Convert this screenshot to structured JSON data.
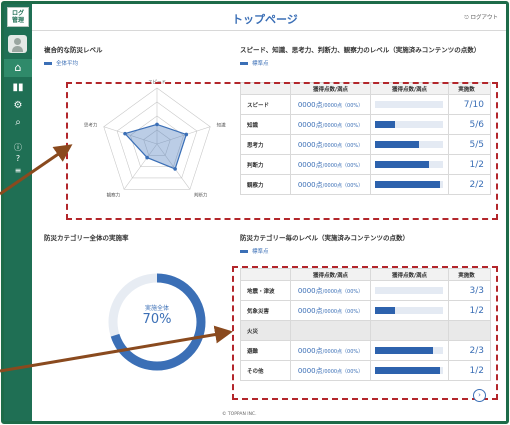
{
  "app": {
    "logo": "ログ\n管理",
    "title": "トップページ",
    "logout": "ログアウト"
  },
  "left_top": {
    "title": "複合的な防災レベル",
    "legend": "全体平均"
  },
  "right_top": {
    "title": "スピード、知識、思考力、判断力、観察力のレベル（実施済みコンテンツの点数）",
    "legend": "標準点",
    "headers": [
      "",
      "獲得点数/満点",
      "獲得点数/満点",
      "実施数"
    ],
    "rows": [
      {
        "name": "スピード",
        "score": "0000点",
        "detail": "/0000点（00%）",
        "fill": 0.0,
        "count": "7/10"
      },
      {
        "name": "知識",
        "score": "0000点",
        "detail": "/0000点（00%）",
        "fill": 0.3,
        "count": "5/6"
      },
      {
        "name": "思考力",
        "score": "0000点",
        "detail": "/0000点（00%）",
        "fill": 0.65,
        "count": "5/5"
      },
      {
        "name": "判断力",
        "score": "0000点",
        "detail": "/0000点（00%）",
        "fill": 0.8,
        "count": "1/2"
      },
      {
        "name": "観察力",
        "score": "0000点",
        "detail": "/0000点（00%）",
        "fill": 0.95,
        "count": "2/2"
      }
    ]
  },
  "left_bottom": {
    "title": "防災カテゴリー全体の実施率",
    "donut_label": "実施全体",
    "percent": "70%",
    "rate": 0.7
  },
  "right_bottom": {
    "title": "防災カテゴリー毎のレベル（実施済みコンテンツの点数）",
    "legend": "標準点",
    "headers": [
      "",
      "獲得点数/満点",
      "獲得点数/満点",
      "実施数"
    ],
    "rows": [
      {
        "name": "地震・津波",
        "score": "0000点",
        "detail": "/0000点（00%）",
        "fill": 0.0,
        "count": "3/3",
        "gray": false
      },
      {
        "name": "気象災害",
        "score": "0000点",
        "detail": "/0000点（00%）",
        "fill": 0.3,
        "count": "1/2",
        "gray": false
      },
      {
        "name": "火災",
        "score": "",
        "detail": "",
        "fill": null,
        "count": "",
        "gray": true
      },
      {
        "name": "避難",
        "score": "0000点",
        "detail": "/0000点（00%）",
        "fill": 0.85,
        "count": "2/3",
        "gray": false
      },
      {
        "name": "その他",
        "score": "0000点",
        "detail": "/0000点（00%）",
        "fill": 0.95,
        "count": "1/2",
        "gray": false
      }
    ]
  },
  "radar": {
    "axes": [
      "スピード",
      "知識",
      "判断力",
      "観察力",
      "思考力"
    ],
    "values": [
      0.35,
      0.55,
      0.55,
      0.3,
      0.6
    ],
    "color": "#3b6fb6"
  },
  "footer": "© TOPPAN INC.",
  "colors": {
    "sidebar": "#1f6f54",
    "accent": "#3b6fb6",
    "highlight": "#b3262b",
    "arrow": "#8a4a1e"
  },
  "icons": [
    "home-icon",
    "chart-icon",
    "gear-icon",
    "search-icon",
    "info-icon",
    "help-icon",
    "list-icon",
    "chevron-right-icon"
  ]
}
